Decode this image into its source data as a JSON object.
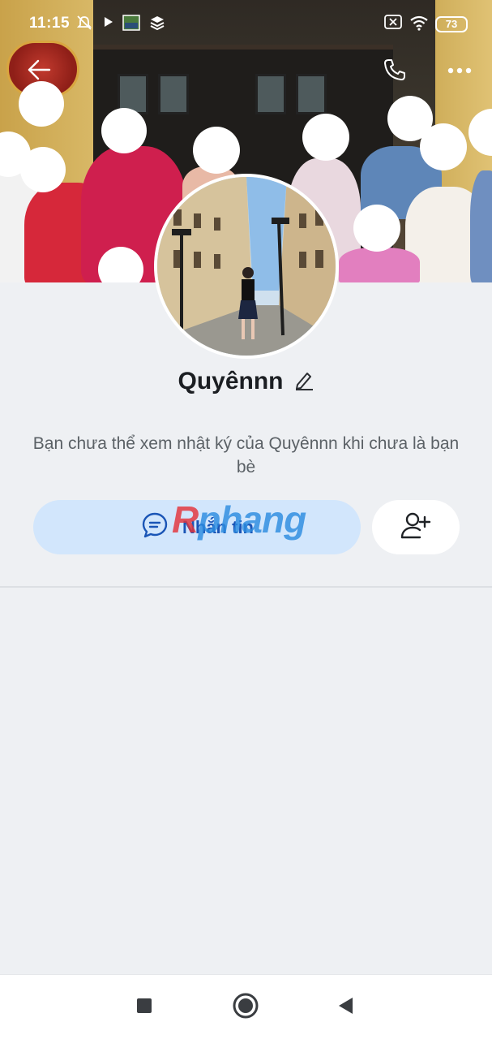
{
  "status_bar": {
    "time": "11:15",
    "battery": "73",
    "icons": [
      "bell-off-icon",
      "play-icon",
      "photo-thumbnail-icon",
      "layers-icon",
      "x-box-icon",
      "wifi-icon",
      "battery-icon"
    ]
  },
  "header": {
    "back_icon": "arrow-left-icon",
    "call_icon": "phone-icon",
    "more_icon": "more-horizontal-icon"
  },
  "profile": {
    "name": "Quyênnn",
    "edit_icon": "pencil-icon",
    "notice": "Bạn chưa thể xem nhật ký của Quyênnn khi chưa là bạn bè"
  },
  "actions": {
    "message_label": "Nhắn tin",
    "message_icon": "chat-bubble-icon",
    "add_friend_icon": "user-plus-icon"
  },
  "watermark": {
    "prefix": "R",
    "rest": "phang"
  },
  "nav": {
    "recents_icon": "square-icon",
    "home_icon": "circle-icon",
    "back_icon": "triangle-back-icon"
  },
  "colors": {
    "accent": "#1a55b6",
    "message_button_bg": "#d2e6fc",
    "page_bg": "#eef0f3"
  }
}
